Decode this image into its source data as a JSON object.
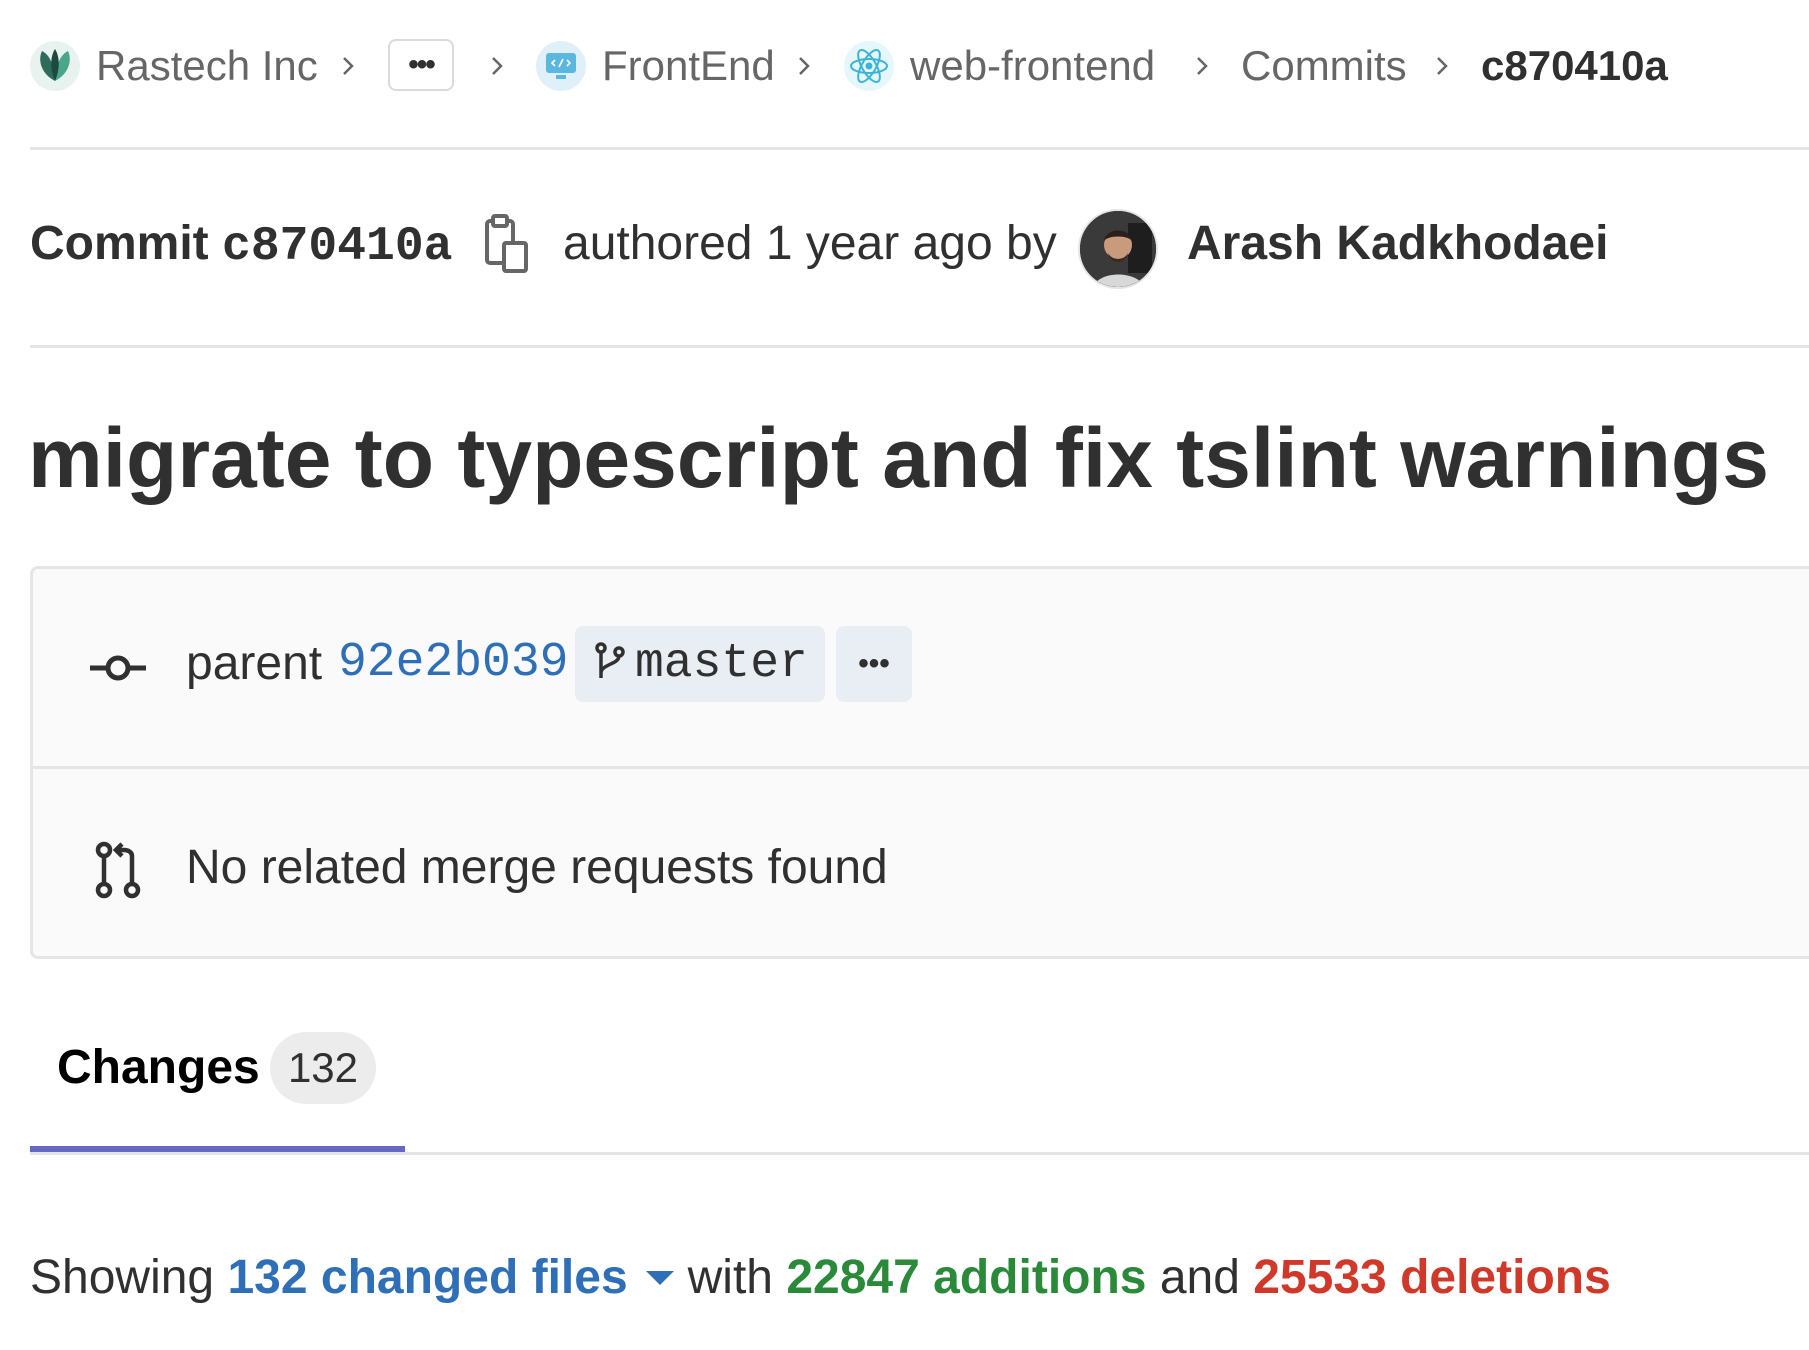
{
  "breadcrumb": {
    "items": [
      {
        "label": "Rastech Inc",
        "icon": "rastech-logo-icon"
      },
      {
        "label": "…",
        "icon": "ellipsis-icon"
      },
      {
        "label": "FrontEnd",
        "icon": "code-monitor-icon"
      },
      {
        "label": "web-frontend",
        "icon": "react-icon"
      },
      {
        "label": "Commits"
      },
      {
        "label": "c870410a"
      }
    ]
  },
  "commit": {
    "prefix": "Commit",
    "sha": "c870410a",
    "authored_text": "authored 1 year ago by",
    "author": "Arash Kadkhodaei",
    "message": "migrate to typescript and fix tslint warnings"
  },
  "info": {
    "parent_label": "parent",
    "parent_sha": "92e2b039",
    "branch": "master",
    "more": "•••",
    "merge_requests": "No related merge requests found"
  },
  "tabs": [
    {
      "label": "Changes",
      "count": "132",
      "active": true
    }
  ],
  "summary": {
    "showing": "Showing",
    "files": "132 changed files",
    "with": "with",
    "additions": "22847 additions",
    "and": "and",
    "deletions": "25533 deletions"
  },
  "colors": {
    "link": "#2f6fb8",
    "additions": "#2a8a3a",
    "deletions": "#d0392a",
    "tab_active": "#6666c4"
  }
}
